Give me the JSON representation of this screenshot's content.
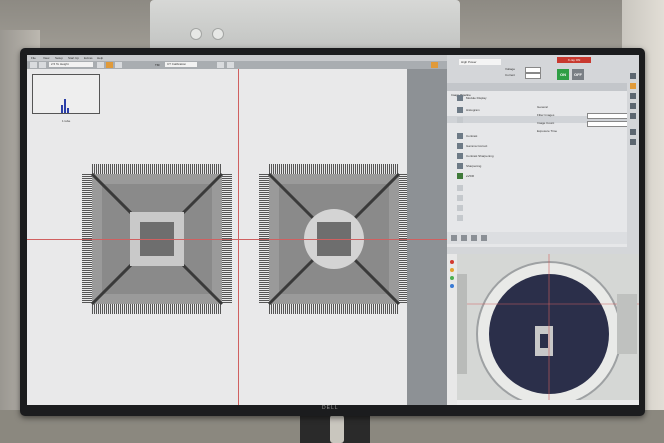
{
  "menu": [
    "File",
    "View",
    "Setup",
    "Start Up",
    "Extras",
    "Help"
  ],
  "toolbar": {
    "select1": "2.5 To Height",
    "label": "TM:",
    "select2": "CT Calibration"
  },
  "histogram": {
    "label": "1 tube"
  },
  "right_panel": {
    "mode_select": "High Power",
    "xray_status": "X-ray ON",
    "voltage_label": "Voltage",
    "current_label": "Current",
    "on_label": "ON",
    "off_label": "OFF",
    "subhead": "Image Pipeline",
    "rows": [
      {
        "label": "Module Display",
        "dim": false
      },
      {
        "label": "Histogram",
        "dim": false
      },
      {
        "label": "",
        "dim": true
      },
      {
        "label": "Contrast",
        "dim": false
      },
      {
        "label": "Gamma Correct",
        "dim": false
      },
      {
        "label": "Contrast Sharpening",
        "dim": false
      },
      {
        "label": "Sharpening",
        "dim": false
      },
      {
        "label": "eVDR",
        "dim": false
      },
      {
        "label": "",
        "dim": true
      },
      {
        "label": "",
        "dim": true
      },
      {
        "label": "",
        "dim": true
      },
      {
        "label": "",
        "dim": true
      }
    ],
    "settings": {
      "general": "General",
      "filter": "Filter Images",
      "image_count": "Image Count",
      "exposure": "Exposure Time"
    }
  },
  "camera_panel": {
    "title": "Navigator"
  },
  "monitor_brand": "DELL",
  "colors": {
    "accent_red": "#c8392f",
    "on_green": "#2f9e45",
    "off_gray": "#7a7f85",
    "crosshair": "#d06060"
  }
}
